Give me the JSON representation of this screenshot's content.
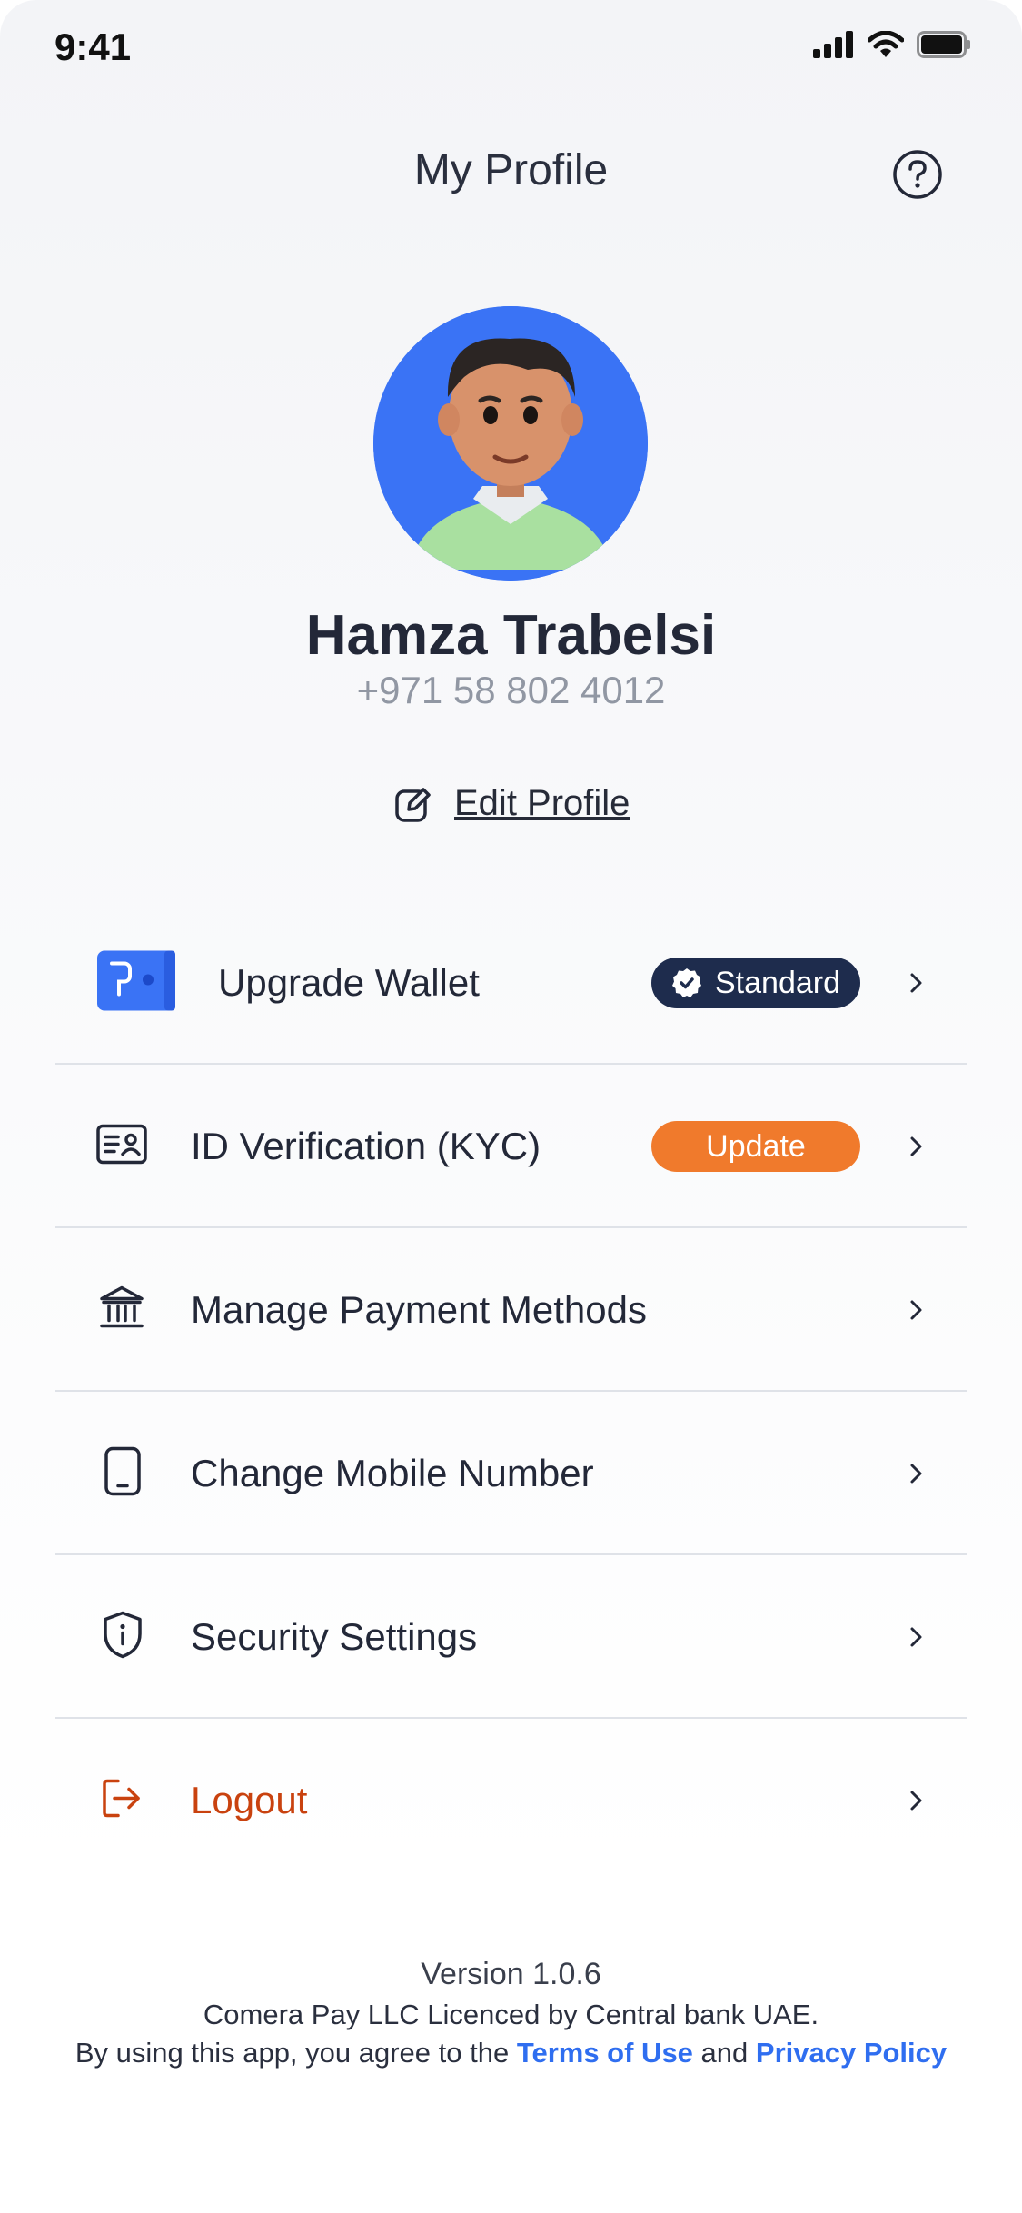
{
  "status_bar": {
    "time": "9:41"
  },
  "header": {
    "title": "My Profile",
    "help_icon": "help-circle-icon"
  },
  "profile": {
    "name": "Hamza Trabelsi",
    "phone": "+971 58 802 4012",
    "avatar_bg": "#3a73f5",
    "edit_label": "Edit Profile"
  },
  "menu": {
    "items": [
      {
        "label": "Upgrade Wallet",
        "icon": "wallet-icon",
        "badge": "Standard",
        "badge_icon": "verified-check-icon"
      },
      {
        "label": "ID Verification (KYC)",
        "icon": "id-card-icon",
        "badge": "Update"
      },
      {
        "label": "Manage Payment Methods",
        "icon": "bank-icon"
      },
      {
        "label": "Change Mobile Number",
        "icon": "mobile-phone-icon"
      },
      {
        "label": "Security Settings",
        "icon": "shield-info-icon"
      },
      {
        "label": "Logout",
        "icon": "logout-icon",
        "color": "#c9420f"
      }
    ]
  },
  "footer": {
    "version": "Version 1.0.6",
    "licence": "Comera Pay LLC Licenced by Central bank UAE.",
    "agree_prefix": "By using this app, you agree to the ",
    "terms_link": "Terms of Use",
    "and_text": " and ",
    "privacy_link": "Privacy Policy",
    "link_color": "#2f6ef0"
  },
  "colors": {
    "accent_blue": "#3a73f5",
    "badge_dark": "#1e2c4d",
    "badge_orange": "#f07a2c",
    "logout_red": "#c9420f"
  }
}
